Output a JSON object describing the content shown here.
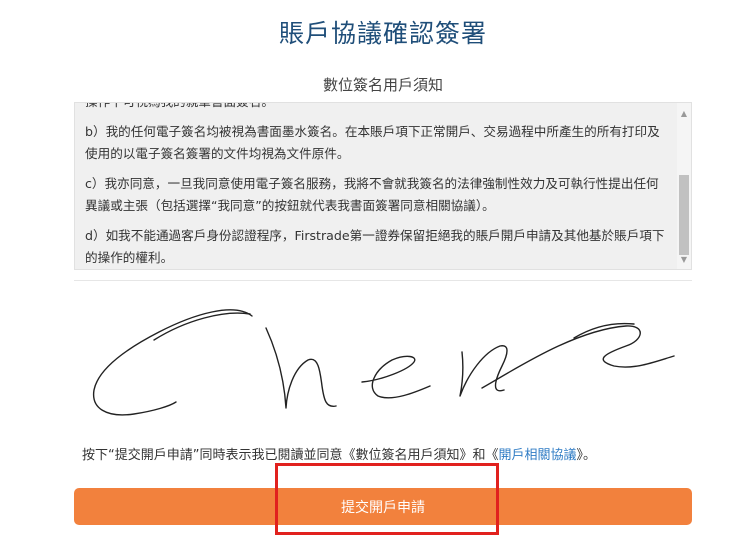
{
  "page": {
    "title": "賬戶協議確認簽署",
    "subtitle": "數位簽名用戶須知"
  },
  "terms": {
    "clipped_line": "操作下可視為我的親筆書面簽名。",
    "paragraphs": [
      "b）我的任何電子簽名均被視為書面墨水簽名。在本賬戶項下正常開戶、交易過程中所產生的所有打印及使用的以電子簽名簽署的文件均視為文件原件。",
      "c）我亦同意，一旦我同意使用電子簽名服務，我將不會就我簽名的法律強制性效力及可執行性提出任何異議或主張（包括選擇“我同意”的按鈕就代表我書面簽署同意相關協議）。",
      "d）如我不能通過客戶身份認證程序，Firstrade第一證券保留拒絕我的賬戶開戶申請及其他基於賬戶項下的操作的權利。"
    ],
    "scroll_up_icon": "triangle-up",
    "scroll_down_icon": "triangle-down"
  },
  "signature": {
    "stroke_color": "#222222"
  },
  "consent": {
    "prefix": "按下“提交開戶申請”同時表示我已閱讀並同意《數位簽名用戶須知》和《",
    "link": "開戶相關協議",
    "suffix": "》。"
  },
  "submit": {
    "label": "提交開戶申請"
  },
  "colors": {
    "title": "#1f4e79",
    "button": "#f2813d",
    "link": "#2e7bc4",
    "highlight": "#e1211e"
  }
}
